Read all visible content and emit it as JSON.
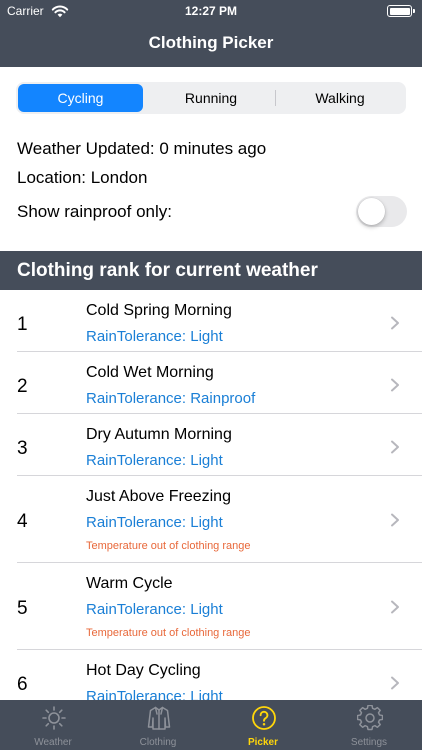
{
  "status_bar": {
    "carrier": "Carrier",
    "time": "12:27 PM"
  },
  "nav": {
    "title": "Clothing Picker"
  },
  "activity_tabs": [
    {
      "label": "Cycling",
      "selected": true
    },
    {
      "label": "Running",
      "selected": false
    },
    {
      "label": "Walking",
      "selected": false
    }
  ],
  "info": {
    "weather_updated": "Weather Updated: 0 minutes ago",
    "location": "Location: London",
    "rainproof_label": "Show rainproof only:",
    "rainproof_on": false
  },
  "section": {
    "title": "Clothing rank for current weather"
  },
  "clothing": [
    {
      "rank": "1",
      "name": "Cold Spring Morning",
      "rain": "RainTolerance: Light",
      "warning": ""
    },
    {
      "rank": "2",
      "name": "Cold Wet Morning",
      "rain": "RainTolerance: Rainproof",
      "warning": ""
    },
    {
      "rank": "3",
      "name": "Dry Autumn Morning",
      "rain": "RainTolerance: Light",
      "warning": ""
    },
    {
      "rank": "4",
      "name": "Just Above Freezing",
      "rain": "RainTolerance: Light",
      "warning": "Temperature out of clothing range"
    },
    {
      "rank": "5",
      "name": "Warm Cycle",
      "rain": "RainTolerance: Light",
      "warning": "Temperature out of clothing range"
    },
    {
      "rank": "6",
      "name": "Hot Day Cycling",
      "rain": "RainTolerance: Light",
      "warning": ""
    }
  ],
  "tabbar": [
    {
      "label": "Weather",
      "icon": "sun-icon",
      "active": false
    },
    {
      "label": "Clothing",
      "icon": "jacket-icon",
      "active": false
    },
    {
      "label": "Picker",
      "icon": "question-circle-icon",
      "active": true
    },
    {
      "label": "Settings",
      "icon": "gear-icon",
      "active": false
    }
  ],
  "colors": {
    "nav_bg": "#454d5a",
    "accent_blue": "#1385ff",
    "link_blue": "#1a7fd6",
    "warning_orange": "#e8683a",
    "active_tab": "#ffd60a",
    "inactive_tab": "#8e929a"
  }
}
